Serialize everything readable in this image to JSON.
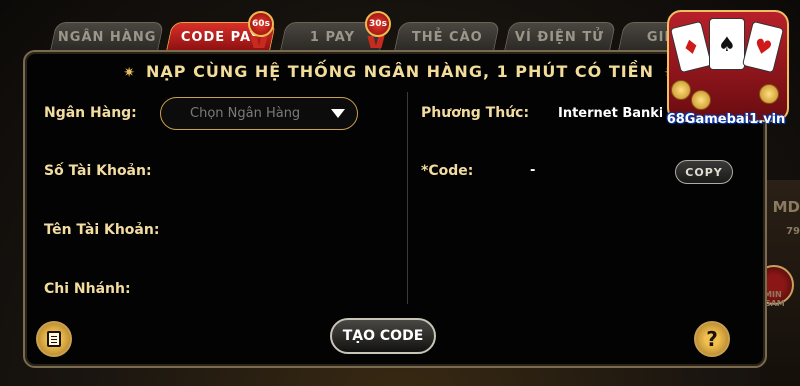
{
  "tabs": [
    {
      "label": "NGÂN HÀNG"
    },
    {
      "label": "CODE PAY",
      "badge": "60s"
    },
    {
      "label": "1 PAY",
      "badge": "30s"
    },
    {
      "label": "THẺ CÀO"
    },
    {
      "label": "VÍ ĐIỆN TỬ"
    },
    {
      "label": "GIF"
    }
  ],
  "title": "NẠP CÙNG HỆ THỐNG NGÂN HÀNG, 1 PHÚT CÓ TIỀN",
  "form": {
    "bank_label": "Ngân Hàng:",
    "bank_placeholder": "Chọn Ngân Hàng",
    "account_number_label": "Số Tài Khoản:",
    "account_name_label": "Tên Tài Khoản:",
    "branch_label": "Chi Nhánh:",
    "method_label": "Phương Thức:",
    "method_value": "Internet Banki",
    "code_label": "*Code:",
    "code_value": "-",
    "copy_label": "COPY",
    "submit_label": "TẠO CODE",
    "help_label": "?"
  },
  "logo": {
    "text": "68Gamebai1.vin"
  },
  "background": {
    "right_text_1": "MD",
    "right_text_2": "79",
    "right_text_3": "MIN GAM"
  },
  "icons": [
    "star-icon",
    "chevron-down-icon",
    "document-icon",
    "help-icon",
    "playing-cards-icon"
  ],
  "colors": {
    "accent_red": "#d8302a",
    "gold": "#f2dca0",
    "panel_bg": "#030303"
  }
}
